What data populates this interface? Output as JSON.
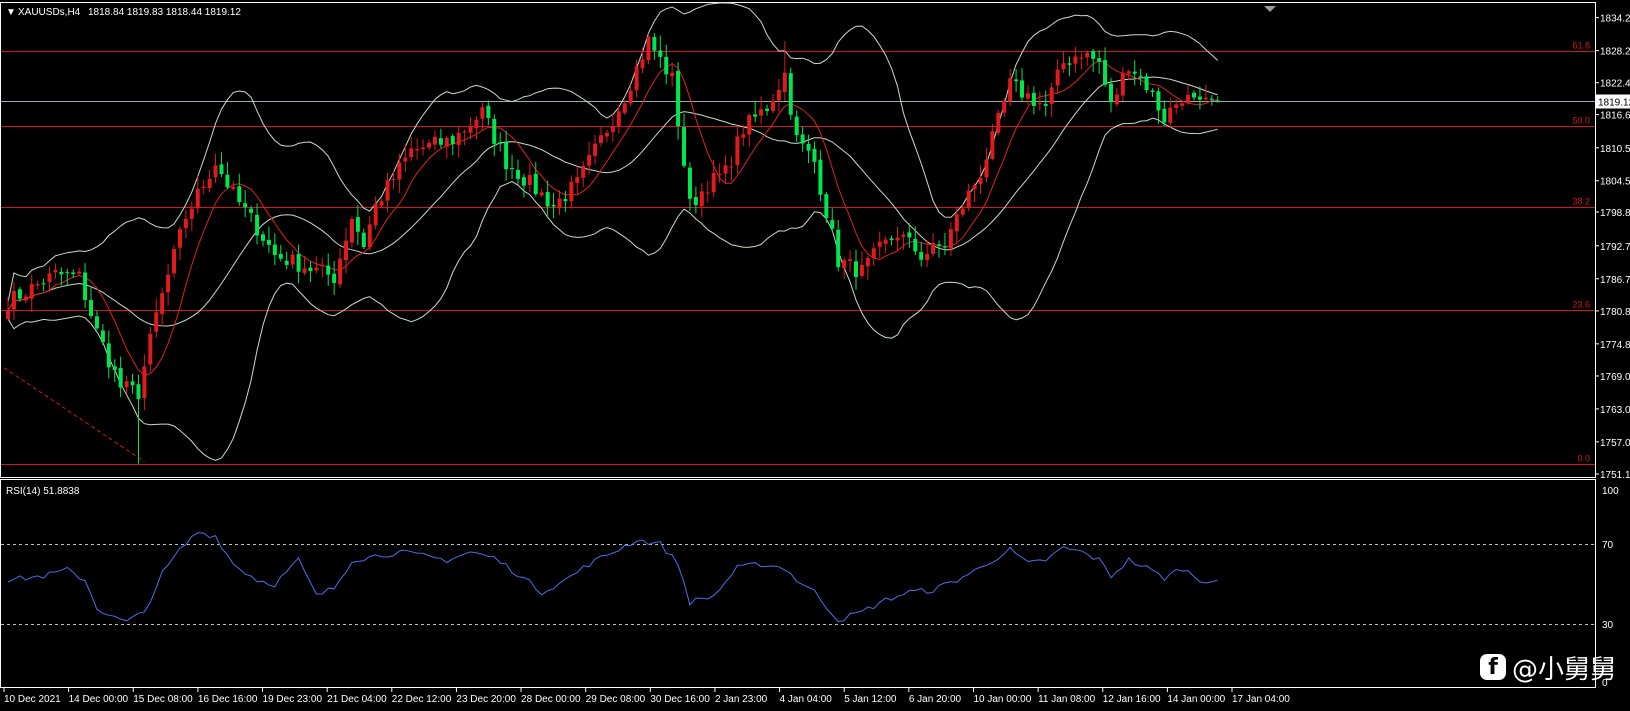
{
  "header": {
    "symbol": "XAUUSDs,H4",
    "ohlc": "1818.84 1819.83 1818.44 1819.12",
    "dropdown_glyph": "▼"
  },
  "rsi_header": "RSI(14) 51.8838",
  "colors": {
    "bull": "#00e64d",
    "bear": "#e01b1b",
    "fib": "#d01818",
    "band": "#c8dcc8",
    "ma": "#e02020",
    "rsi": "#4a70e8",
    "grid": "#c0c0c0"
  },
  "watermark": {
    "icon": "f",
    "text": "@小舅舅"
  },
  "chart_data": [
    {
      "type": "candlestick",
      "title": "",
      "symbol": "XAUUSDs,H4",
      "ylim": [
        1751.15,
        1836.0
      ],
      "price_ticks": [
        "1834.25",
        "1828.25",
        "1822.40",
        "1816.60",
        "1810.55",
        "1804.55",
        "1798.85",
        "1792.70",
        "1786.70",
        "1780.85",
        "1774.85",
        "1769.00",
        "1763.00",
        "1757.00",
        "1751.15"
      ],
      "current_price": "1819.12",
      "x_tick_labels": [
        "10 Dec 2021",
        "14 Dec 00:00",
        "15 Dec 08:00",
        "16 Dec 16:00",
        "19 Dec 23:00",
        "21 Dec 04:00",
        "22 Dec 12:00",
        "23 Dec 20:00",
        "28 Dec 00:00",
        "29 Dec 08:00",
        "30 Dec 16:00",
        "2 Jan 23:00",
        "4 Jan 04:00",
        "5 Jan 12:00",
        "6 Jan 20:00",
        "10 Jan 00:00",
        "11 Jan 08:00",
        "12 Jan 16:00",
        "14 Jan 00:00",
        "17 Jan 04:00"
      ],
      "fibonacci": [
        {
          "label": "61.8",
          "price": 1828.2
        },
        {
          "label": "50.0",
          "price": 1814.6
        },
        {
          "label": "38.2",
          "price": 1799.7
        },
        {
          "label": "23.6",
          "price": 1781.1
        },
        {
          "label": "0.0",
          "price": 1753.0
        }
      ],
      "close_anchors": [
        [
          0,
          1782.5
        ],
        [
          8,
          1787.5
        ],
        [
          12,
          1787.0
        ],
        [
          15,
          1777.0
        ],
        [
          19,
          1767.0
        ],
        [
          22,
          1766.0
        ],
        [
          25,
          1780.0
        ],
        [
          30,
          1798.0
        ],
        [
          35,
          1808.0
        ],
        [
          38,
          1802.0
        ],
        [
          42,
          1796.0
        ],
        [
          45,
          1791.0
        ],
        [
          50,
          1789.0
        ],
        [
          55,
          1787.0
        ],
        [
          58,
          1798.0
        ],
        [
          60,
          1793.0
        ],
        [
          62,
          1800.0
        ],
        [
          68,
          1810.0
        ],
        [
          75,
          1812.0
        ],
        [
          80,
          1817.0
        ],
        [
          84,
          1808.0
        ],
        [
          88,
          1804.0
        ],
        [
          92,
          1800.0
        ],
        [
          96,
          1804.0
        ],
        [
          100,
          1812.0
        ],
        [
          104,
          1820.0
        ],
        [
          108,
          1830.0
        ],
        [
          112,
          1823.0
        ],
        [
          115,
          1800.0
        ],
        [
          118,
          1804.0
        ],
        [
          121,
          1806.0
        ],
        [
          124,
          1814.0
        ],
        [
          128,
          1818.0
        ],
        [
          131,
          1824.0
        ],
        [
          133,
          1812.0
        ],
        [
          136,
          1808.0
        ],
        [
          140,
          1790.0
        ],
        [
          144,
          1788.0
        ],
        [
          147,
          1792.0
        ],
        [
          150,
          1795.0
        ],
        [
          154,
          1791.0
        ],
        [
          158,
          1793.0
        ],
        [
          161,
          1800.0
        ],
        [
          164,
          1806.0
        ],
        [
          166,
          1812.0
        ],
        [
          169,
          1822.0
        ],
        [
          172,
          1820.0
        ],
        [
          175,
          1818.0
        ],
        [
          178,
          1826.0
        ],
        [
          181,
          1828.0
        ],
        [
          184,
          1826.0
        ],
        [
          186,
          1818.0
        ],
        [
          189,
          1826.0
        ],
        [
          192,
          1822.0
        ],
        [
          195,
          1816.0
        ],
        [
          198,
          1820.0
        ],
        [
          201,
          1818.0
        ],
        [
          204,
          1819.12
        ]
      ]
    },
    {
      "type": "line",
      "title": "RSI(14) 51.8838",
      "ylim": [
        0,
        100
      ],
      "y_ticks": [
        "100",
        "70",
        "30",
        "0"
      ],
      "levels": [
        70,
        30
      ],
      "anchors": [
        [
          0,
          52.0
        ],
        [
          6,
          54.0
        ],
        [
          10,
          57.0
        ],
        [
          13,
          52.0
        ],
        [
          15,
          38.0
        ],
        [
          18,
          33.0
        ],
        [
          20,
          31.0
        ],
        [
          23,
          36.0
        ],
        [
          26,
          55.0
        ],
        [
          29,
          67.0
        ],
        [
          32,
          76.0
        ],
        [
          35,
          74.0
        ],
        [
          38,
          60.0
        ],
        [
          42,
          52.0
        ],
        [
          45,
          50.0
        ],
        [
          49,
          62.0
        ],
        [
          52,
          44.0
        ],
        [
          55,
          48.0
        ],
        [
          58,
          62.0
        ],
        [
          62,
          64.0
        ],
        [
          66,
          66.0
        ],
        [
          70,
          64.0
        ],
        [
          74,
          62.0
        ],
        [
          78,
          66.0
        ],
        [
          82,
          63.0
        ],
        [
          86,
          55.0
        ],
        [
          90,
          46.0
        ],
        [
          94,
          52.0
        ],
        [
          98,
          60.0
        ],
        [
          102,
          66.0
        ],
        [
          106,
          72.0
        ],
        [
          110,
          70.0
        ],
        [
          113,
          60.0
        ],
        [
          115,
          41.0
        ],
        [
          119,
          44.0
        ],
        [
          123,
          58.0
        ],
        [
          127,
          60.0
        ],
        [
          131,
          58.0
        ],
        [
          133,
          52.0
        ],
        [
          136,
          46.0
        ],
        [
          140,
          32.0
        ],
        [
          144,
          36.0
        ],
        [
          148,
          42.0
        ],
        [
          152,
          46.0
        ],
        [
          156,
          47.0
        ],
        [
          160,
          52.0
        ],
        [
          164,
          58.0
        ],
        [
          166,
          62.0
        ],
        [
          169,
          67.0
        ],
        [
          172,
          60.0
        ],
        [
          175,
          62.0
        ],
        [
          178,
          68.0
        ],
        [
          181,
          66.0
        ],
        [
          184,
          62.0
        ],
        [
          186,
          54.0
        ],
        [
          189,
          62.0
        ],
        [
          192,
          58.0
        ],
        [
          195,
          53.0
        ],
        [
          198,
          58.0
        ],
        [
          201,
          52.0
        ],
        [
          204,
          51.88
        ]
      ]
    }
  ]
}
